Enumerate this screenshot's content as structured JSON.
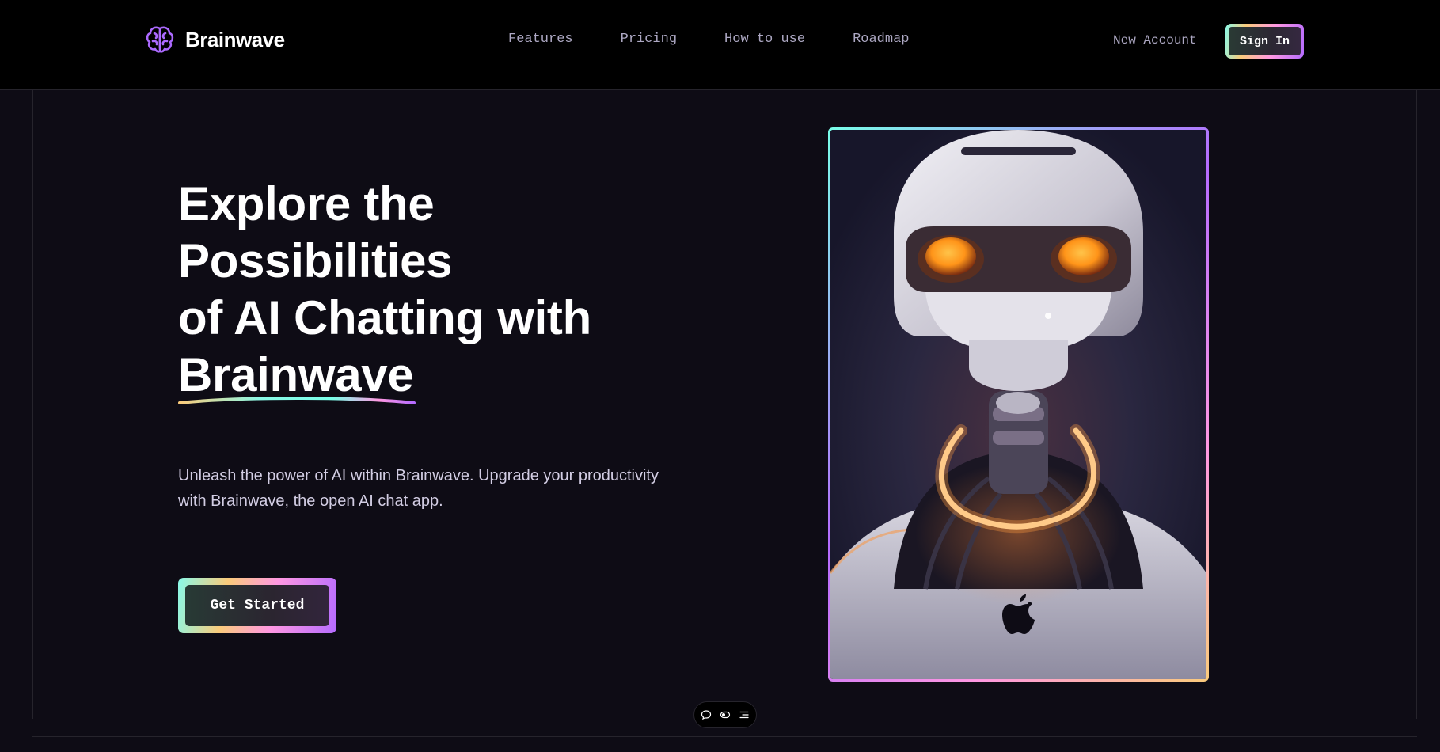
{
  "brand": {
    "name": "Brainwave"
  },
  "nav": {
    "links": [
      {
        "label": "Features"
      },
      {
        "label": "Pricing"
      },
      {
        "label": "How to use"
      },
      {
        "label": "Roadmap"
      }
    ],
    "new_account_label": "New Account",
    "sign_in_label": "Sign In"
  },
  "hero": {
    "title_line1": "Explore the",
    "title_line2": "Possibilities",
    "title_line3": "of AI Chatting with",
    "title_brand": "Brainwave",
    "description": "Unleash the power of AI within Brainwave. Upgrade your productivity with Brainwave, the open AI chat app.",
    "cta_label": "Get Started",
    "image_icon": "robot-illustration"
  },
  "toolbar_icons": [
    "chat-bubble-icon",
    "toggle-icon",
    "list-icon"
  ],
  "colors": {
    "background": "#0e0c15",
    "nav_background": "#000000",
    "accent_purple": "#ac6aff",
    "gradient_cyan": "#89f9e8",
    "gradient_yellow": "#facb7b",
    "gradient_pink": "#ff98e2",
    "nav_text": "#ada8c3"
  }
}
